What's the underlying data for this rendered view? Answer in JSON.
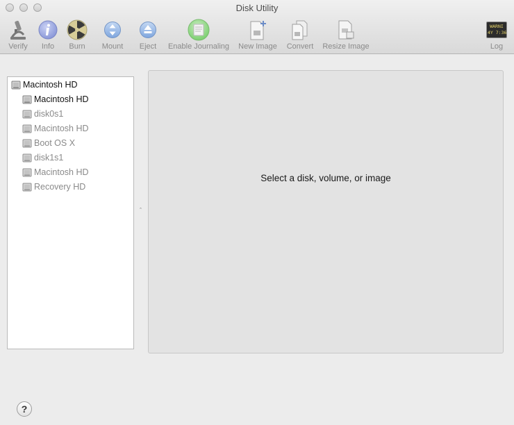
{
  "window": {
    "title": "Disk Utility"
  },
  "toolbar": {
    "verify": "Verify",
    "info": "Info",
    "burn": "Burn",
    "mount": "Mount",
    "eject": "Eject",
    "enable_journaling": "Enable Journaling",
    "new_image": "New Image",
    "convert": "Convert",
    "resize_image": "Resize Image",
    "log": "Log",
    "log_icon_text": [
      "WARNI",
      "4Y 7:36"
    ]
  },
  "sidebar": {
    "items": [
      {
        "label": "Macintosh HD",
        "level": 0,
        "state": "top"
      },
      {
        "label": "Macintosh HD",
        "level": 1,
        "state": "enabled"
      },
      {
        "label": "disk0s1",
        "level": 1,
        "state": "dim"
      },
      {
        "label": "Macintosh HD",
        "level": 1,
        "state": "dim"
      },
      {
        "label": "Boot OS X",
        "level": 1,
        "state": "dim"
      },
      {
        "label": "disk1s1",
        "level": 1,
        "state": "dim"
      },
      {
        "label": "Macintosh HD",
        "level": 1,
        "state": "dim"
      },
      {
        "label": "Recovery HD",
        "level": 1,
        "state": "dim"
      }
    ]
  },
  "main": {
    "message": "Select a disk, volume, or image"
  },
  "help": {
    "label": "?"
  },
  "splitter": {
    "grip": "ˆ"
  }
}
